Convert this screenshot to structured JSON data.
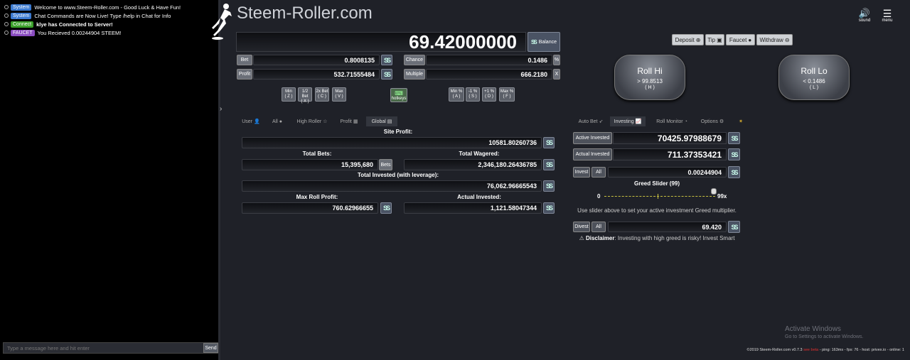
{
  "chat": {
    "messages": [
      {
        "tag": "System",
        "text": "Welcome to www.Steem-Roller.com - Good Luck & Have Fun!",
        "tagColor": "#3b7ad0"
      },
      {
        "tag": "System",
        "text": "Chat Commands are Now Live! Type /help in Chat for Info",
        "tagColor": "#3b7ad0"
      },
      {
        "tag": "Connect",
        "text": "klye has Connected to Server!",
        "tagColor": "#3aa02a"
      },
      {
        "tag": "FAUCET",
        "text": "You Recieved 0.00244904 STEEM!",
        "tagColor": "#8a4cc0"
      }
    ],
    "input_placeholder": "Type a message here and hit enter",
    "send_label": "Send"
  },
  "header": {
    "logo": "Steem-Roller.com",
    "sound_label": "sound",
    "menu_label": "menu"
  },
  "balance": {
    "value": "69.42000000",
    "label": "Balance"
  },
  "bet": {
    "label": "Bet",
    "value": "0.8008135"
  },
  "chance": {
    "label": "Chance",
    "value": "0.1486",
    "suffix": "%"
  },
  "profit": {
    "label": "Profit",
    "value": "532.71555484"
  },
  "multiple": {
    "label": "Multiple",
    "value": "666.2180",
    "suffix": "X"
  },
  "bet_buttons": [
    {
      "top": "Min",
      "bottom": "( Z )"
    },
    {
      "top": "1/2 Bet",
      "bottom": "( X )"
    },
    {
      "top": "2x Bet",
      "bottom": "( C )"
    },
    {
      "top": "Max",
      "bottom": "( V )"
    }
  ],
  "hotkeys_label": "hotkeys",
  "chance_buttons": [
    {
      "top": "Min %",
      "bottom": "( A )"
    },
    {
      "top": "-1 %",
      "bottom": "( S )"
    },
    {
      "top": "+1 %",
      "bottom": "( D )"
    },
    {
      "top": "Max %",
      "bottom": "( F )"
    }
  ],
  "actions": {
    "deposit": "Deposit",
    "tip": "Tip",
    "faucet": "Faucet",
    "withdraw": "Withdraw"
  },
  "roll_hi": {
    "title": "Roll Hi",
    "sub": "> 99.8513",
    "key": "( H )"
  },
  "roll_lo": {
    "title": "Roll Lo",
    "sub": "< 0.1486",
    "key": "( L )"
  },
  "stats_tabs": [
    "User",
    "All",
    "High Roller",
    "Profit",
    "Global"
  ],
  "stats": {
    "site_profit_label": "Site Profit:",
    "site_profit": "10581.80260736",
    "total_bets_label": "Total Bets:",
    "total_bets": "15,395,680",
    "bets_unit": "Bets",
    "total_wagered_label": "Total Wagered:",
    "total_wagered": "2,346,180.26436785",
    "total_invested_label": "Total Invested (with leverage):",
    "total_invested": "76,062.96665543",
    "max_roll_profit_label": "Max Roll Profit:",
    "max_roll_profit": "760.62966655",
    "actual_invested_label": "Actual Invested:",
    "actual_invested": "1,121.58047344"
  },
  "invest_tabs": [
    "Auto Bet",
    "Investing",
    "Roll Monitor",
    "Options"
  ],
  "invest": {
    "active_label": "Active Invested",
    "active_value": "70425.97988679",
    "actual_label": "Actual Invested",
    "actual_value": "711.37353421",
    "invest_label": "Invest",
    "all_label": "All",
    "invest_value": "0.00244904",
    "greed_label": "Greed Slider (99)",
    "greed_min": "0",
    "greed_max": "99x",
    "greed_level": 0.99,
    "greed_help": "Use slider above to set your active investment Greed multiplier.",
    "divest_label": "Divest",
    "divest_value": "69.420",
    "disclaimer_bold": "Disclaimer",
    "disclaimer_text": ": Investing with high greed is risky! Invest Smart"
  },
  "watermark": {
    "title": "Activate Windows",
    "sub": "Go to Settings to activate Windows."
  },
  "footer": {
    "prefix": "©2019 Steem-Roller.com v0.7.3",
    "link": "see beta",
    "suffix": "- ping: 163ms - fps: 76 - host: privex.io - online: 1"
  }
}
